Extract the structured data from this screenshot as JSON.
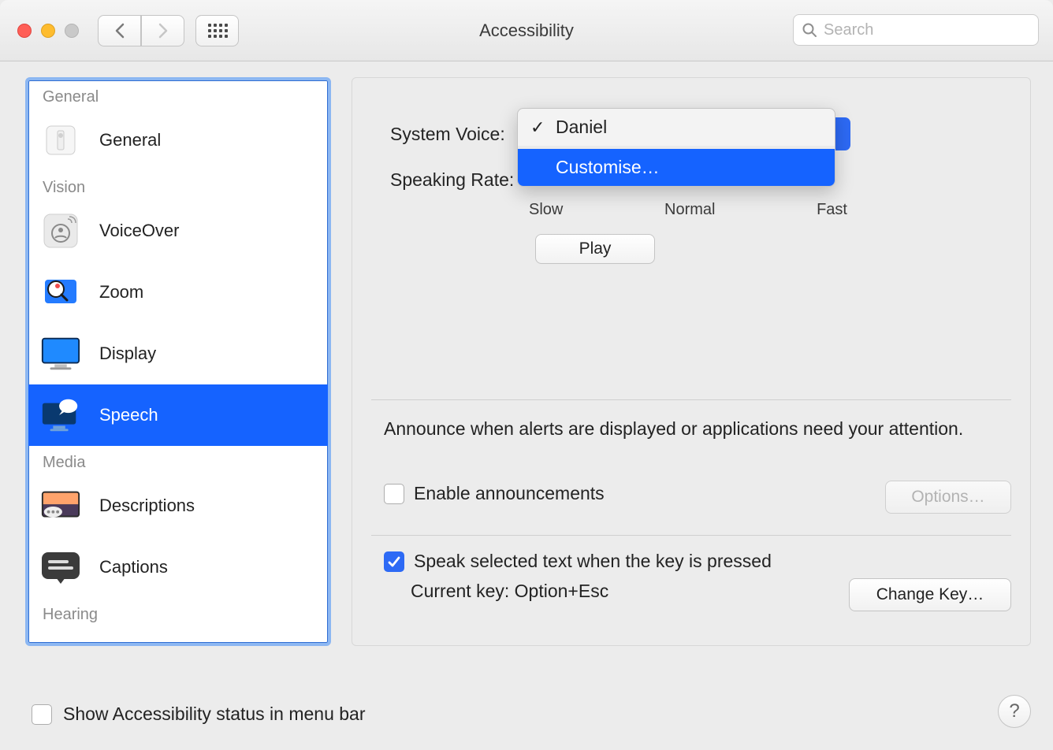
{
  "window": {
    "title": "Accessibility"
  },
  "search": {
    "placeholder": "Search"
  },
  "sidebar": {
    "groups": [
      {
        "header": "General",
        "items": [
          {
            "id": "general",
            "label": "General",
            "selected": false
          }
        ]
      },
      {
        "header": "Vision",
        "items": [
          {
            "id": "voiceover",
            "label": "VoiceOver",
            "selected": false
          },
          {
            "id": "zoom",
            "label": "Zoom",
            "selected": false
          },
          {
            "id": "display",
            "label": "Display",
            "selected": false
          },
          {
            "id": "speech",
            "label": "Speech",
            "selected": true
          }
        ]
      },
      {
        "header": "Media",
        "items": [
          {
            "id": "descriptions",
            "label": "Descriptions",
            "selected": false
          },
          {
            "id": "captions",
            "label": "Captions",
            "selected": false
          }
        ]
      },
      {
        "header": "Hearing",
        "items": []
      }
    ]
  },
  "content": {
    "system_voice_label": "System Voice:",
    "speaking_rate_label": "Speaking Rate:",
    "rate_ticks": {
      "slow": "Slow",
      "normal": "Normal",
      "fast": "Fast"
    },
    "play_label": "Play",
    "voice_menu": {
      "selected": "Daniel",
      "customise": "Customise…"
    },
    "announce_text": "Announce when alerts are displayed or applications need your attention.",
    "enable_announcements_label": "Enable announcements",
    "enable_announcements_checked": false,
    "options_label": "Options…",
    "speak_selected_label": "Speak selected text when the key is pressed",
    "speak_selected_checked": true,
    "current_key_label": "Current key: Option+Esc",
    "change_key_label": "Change Key…"
  },
  "footer": {
    "show_status_label": "Show Accessibility status in menu bar",
    "show_status_checked": false
  }
}
